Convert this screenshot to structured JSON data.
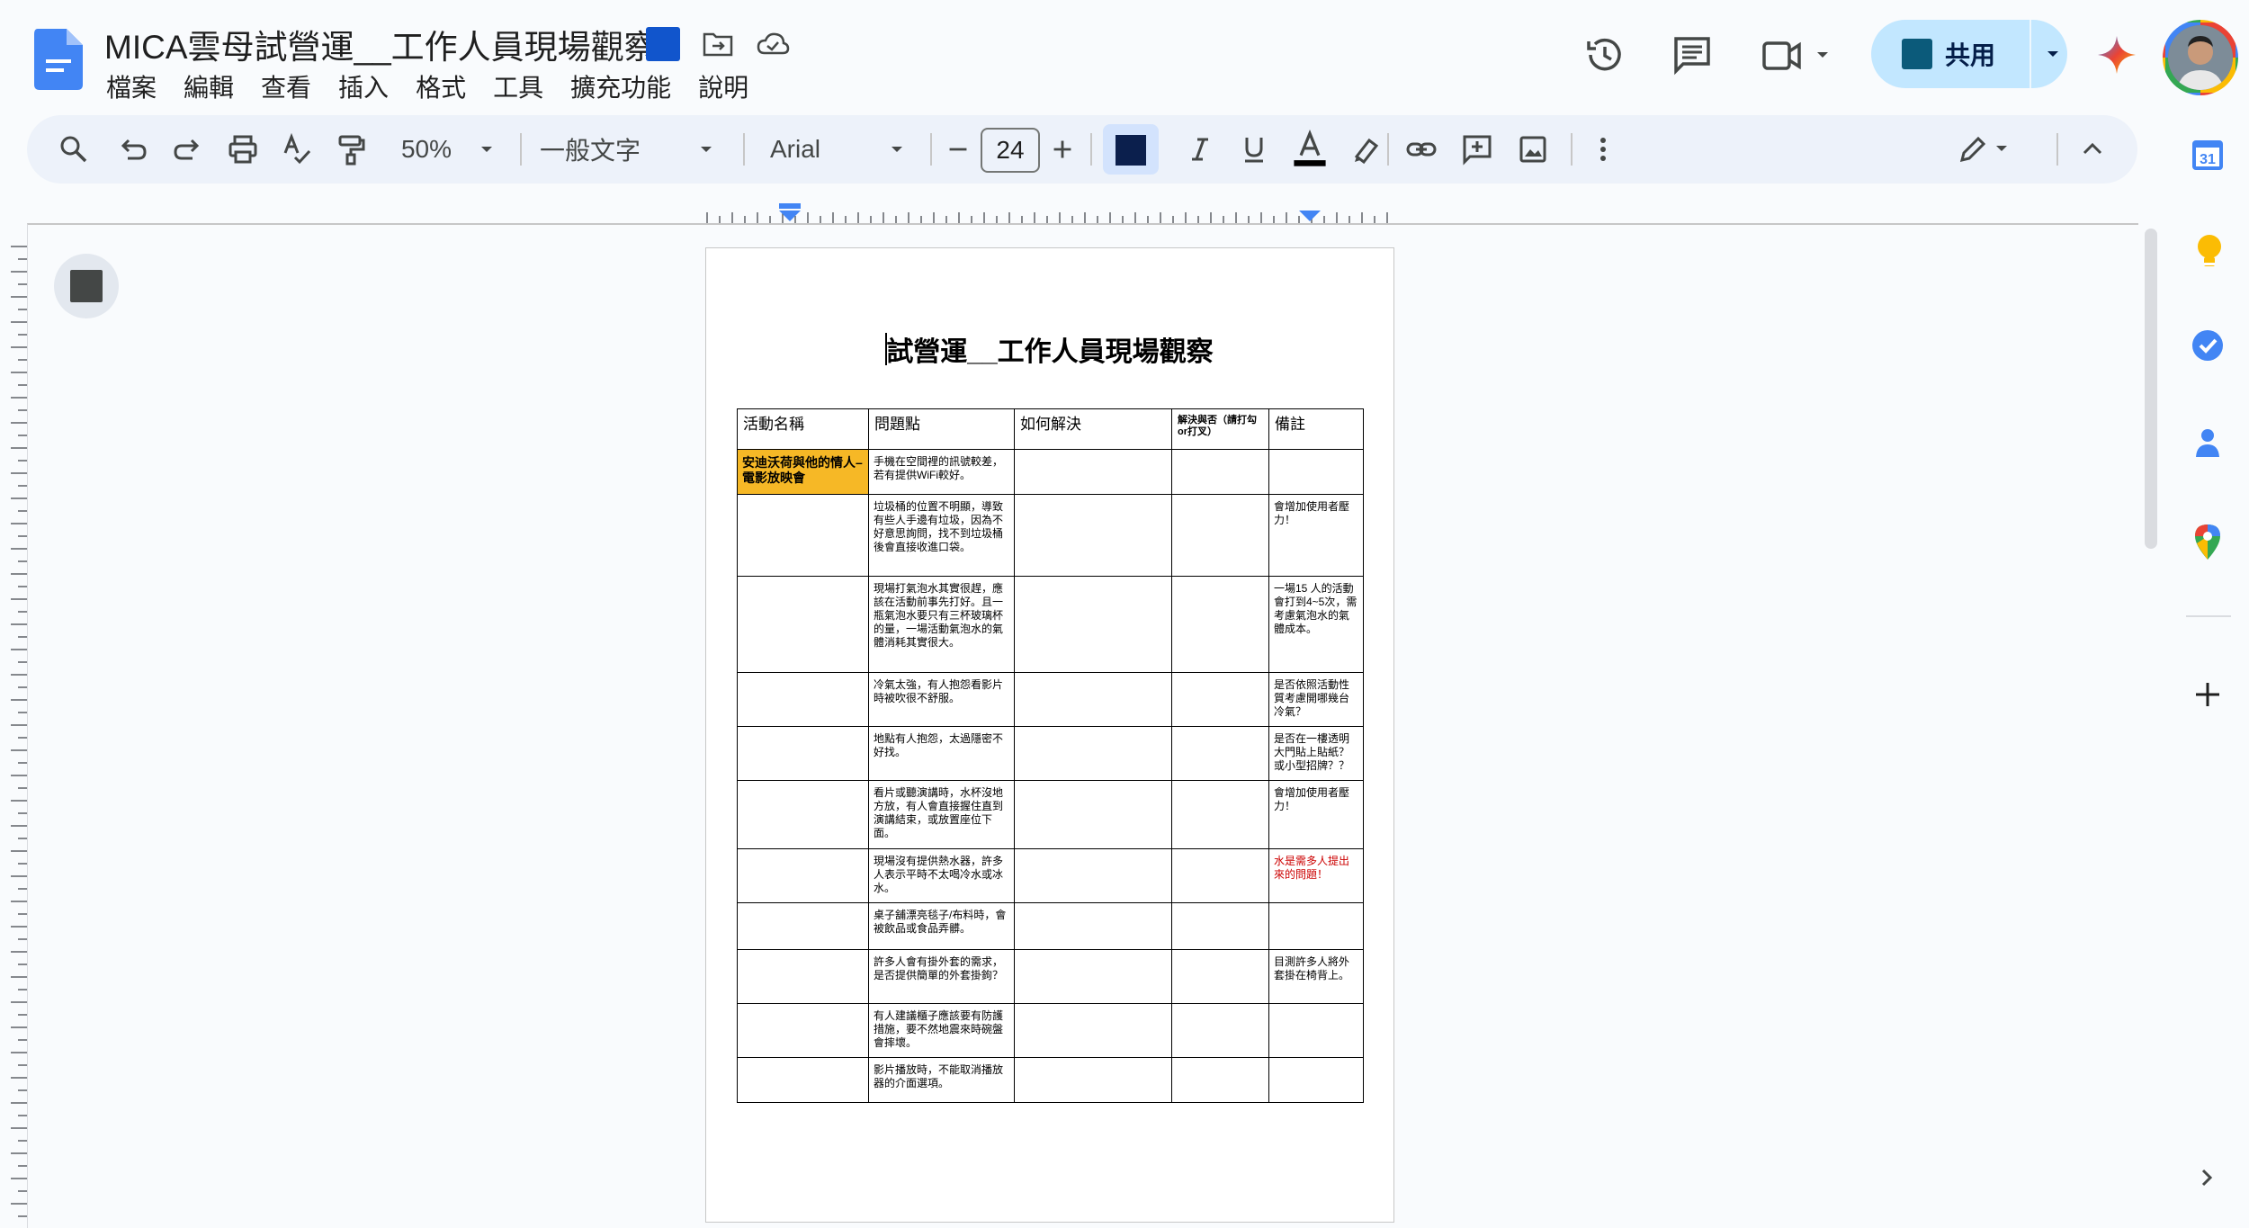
{
  "doc": {
    "title": "MICA雲母試營運__工作人員現場觀察"
  },
  "menu": [
    "檔案",
    "編輯",
    "查看",
    "插入",
    "格式",
    "工具",
    "擴充功能",
    "說明"
  ],
  "share": {
    "label": "共用"
  },
  "toolbar": {
    "zoom": "50%",
    "style": "一般文字",
    "font": "Arial",
    "font_size": "24",
    "text_color": "#0b1f4d"
  },
  "page": {
    "title": "試營運__工作人員現場觀察",
    "table": {
      "headers": [
        "活動名稱",
        "問題點",
        "如何解決",
        "解決與否（請打勾or打叉）",
        "備註"
      ],
      "rows": [
        [
          "安迪沃荷與他的情人–電影放映會",
          "手機在空間裡的訊號較差，若有提供WiFi較好。",
          "",
          "",
          ""
        ],
        [
          "",
          "垃圾桶的位置不明顯，導致有些人手邊有垃圾，因為不好意思詢問，找不到垃圾桶後會直接收進口袋。",
          "",
          "",
          "會增加使用者壓力！"
        ],
        [
          "",
          "現場打氣泡水其實很趕，應該在活動前事先打好。且一瓶氣泡水要只有三杯玻璃杯的量，一場活動氣泡水的氣體消耗其實很大。",
          "",
          "",
          "一場15 人的活動會打到4~5次，需考慮氣泡水的氣體成本。"
        ],
        [
          "",
          "冷氣太強，有人抱怨看影片時被吹很不舒服。",
          "",
          "",
          "是否依照活動性質考慮開哪幾台冷氣？"
        ],
        [
          "",
          "地點有人抱怨，太過隱密不好找。",
          "",
          "",
          "是否在一樓透明大門貼上貼紙？或小型招牌？？"
        ],
        [
          "",
          "看片或聽演講時，水杯沒地方放，有人會直接握住直到演講結束，或放置座位下面。",
          "",
          "",
          "會增加使用者壓力！"
        ],
        [
          "",
          "現場沒有提供熱水器，許多人表示平時不太喝冷水或冰水。",
          "",
          "",
          "水是需多人提出來的問題！"
        ],
        [
          "",
          "桌子舖漂亮毯子/布料時，會被飲品或食品弄髒。",
          "",
          "",
          ""
        ],
        [
          "",
          "許多人會有掛外套的需求，是否提供簡單的外套掛鉤？",
          "",
          "",
          "目測許多人將外套掛在椅背上。"
        ],
        [
          "",
          "有人建議櫃子應該要有防護措施，要不然地震來時碗盤會摔壞。",
          "",
          "",
          ""
        ],
        [
          "",
          "影片播放時，不能取消播放器的介面選項。",
          "",
          "",
          ""
        ]
      ]
    }
  },
  "colors": {
    "accent": "#1155cc",
    "share_bg": "#c2e7ff",
    "activity_highlight": "#f6b826",
    "note_red": "#cc0000"
  },
  "icons": [
    "docs-logo-icon",
    "move-folder-icon",
    "cloud-saved-icon",
    "history-icon",
    "comment-icon",
    "meet-icon",
    "gemini-icon",
    "search-icon",
    "undo-icon",
    "redo-icon",
    "print-icon",
    "spellcheck-icon",
    "paint-format-icon",
    "link-icon",
    "add-comment-icon",
    "image-icon",
    "more-icon",
    "edit-mode-icon",
    "collapse-icon",
    "calendar-icon",
    "keep-icon",
    "tasks-icon",
    "contacts-icon",
    "maps-icon",
    "add-icon"
  ],
  "side_panel": {
    "calendar_day": "31"
  }
}
